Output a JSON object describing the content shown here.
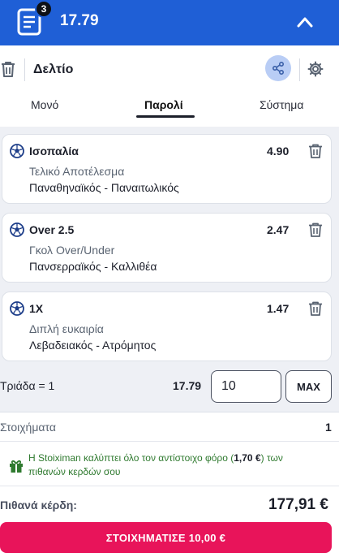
{
  "header": {
    "badge_count": "3",
    "total_odds": "17.79"
  },
  "toolbar": {
    "title": "Δελτίο"
  },
  "tabs": [
    {
      "label": "Μονό"
    },
    {
      "label": "Παρολί"
    },
    {
      "label": "Σύστημα"
    }
  ],
  "selections": [
    {
      "selection": "Ισοπαλία",
      "odds": "4.90",
      "market": "Τελικό Αποτέλεσμα",
      "match": "Παναθηναϊκός - Παναιτωλικός"
    },
    {
      "selection": "Over 2.5",
      "odds": "2.47",
      "market": "Γκολ Over/Under",
      "match": "Πανσερραϊκός - Καλλιθέα"
    },
    {
      "selection": "1X",
      "odds": "1.47",
      "market": "Διπλή ευκαιρία",
      "match": "Λεβαδειακός - Ατρόμητος"
    }
  ],
  "combo": {
    "label": "Τριάδα = 1",
    "odds": "17.79",
    "stake_value": "10",
    "max_label": "MAX"
  },
  "summary": {
    "bets_label": "Στοιχήματα",
    "bets_count": "1",
    "tax_note_prefix": "Η Stoiximan καλύπτει όλο τον αντίστοιχο φόρο (",
    "tax_amount": "1,70 €",
    "tax_note_suffix": ") των πιθανών κερδών σου",
    "potential_win_label": "Πιθανά κέρδη:",
    "potential_win_value": "177,91 €",
    "place_bet_label": "ΣΤΟΙΧΗΜΑΤΙΣΕ 10,00 €"
  },
  "colors": {
    "brand_blue": "#1f5fd6",
    "cta_pink": "#e8145a",
    "tax_green": "#2f7a2f"
  }
}
